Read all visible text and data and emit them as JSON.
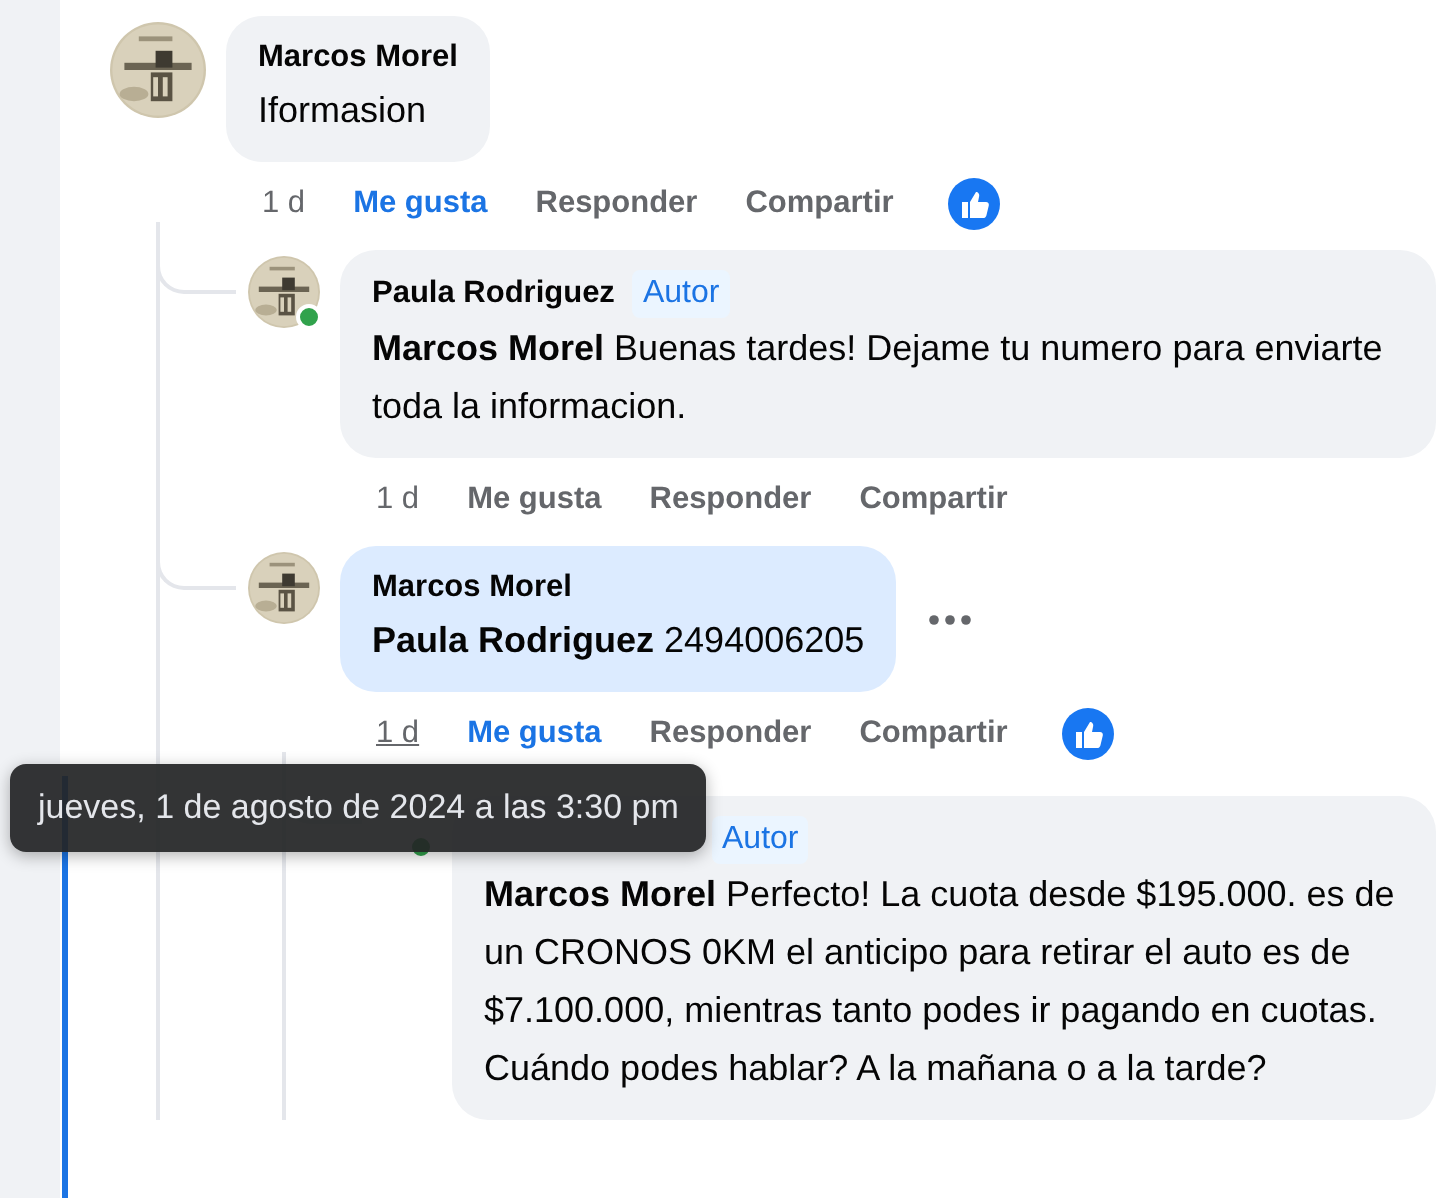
{
  "comments": [
    {
      "avatar": {
        "kind": "picture"
      },
      "author": "Marcos Morel",
      "online": false,
      "text": "Iformasion",
      "highlighted": false,
      "menu_button": false,
      "time": "1 d",
      "time_hovered": false,
      "liked": true,
      "like_reaction": true,
      "actions": [
        "Me gusta",
        "Responder",
        "Compartir"
      ],
      "children": [
        {
          "avatar": {
            "kind": "picture"
          },
          "author": "Paula Rodriguez",
          "online": true,
          "badge": "Autor",
          "text": "**Marcos Morel** Buenas tardes! Dejame tu numero para enviarte toda la informacion.",
          "highlighted": false,
          "menu_button": false,
          "time": "1 d",
          "time_hovered": false,
          "liked": false,
          "like_reaction": false,
          "actions": [
            "Me gusta",
            "Responder",
            "Compartir"
          ]
        },
        {
          "avatar": {
            "kind": "picture"
          },
          "author": "Marcos Morel",
          "online": false,
          "text": "**Paula Rodriguez** 2494006205",
          "highlighted": true,
          "menu_button": true,
          "time": "1 d",
          "time_hovered": true,
          "liked": true,
          "like_reaction": true,
          "actions": [
            "Me gusta",
            "Responder",
            "Compartir"
          ],
          "children": [
            {
              "online": true,
              "badge": "Autor",
              "text": "**Marcos Morel** Perfecto! La cuota desde $195.000. es de un CRONOS 0KM el anticipo para retirar el auto es de $7.100.000, mientras tanto podes ir pagando en cuotas. Cuándo podes hablar? A la mañana o a la tarde?",
              "highlighted": false,
              "menu_button": false
            }
          ]
        }
      ]
    }
  ],
  "tooltip": {
    "text": "jueves, 1 de agosto de 2024 a las 3:30 pm"
  }
}
